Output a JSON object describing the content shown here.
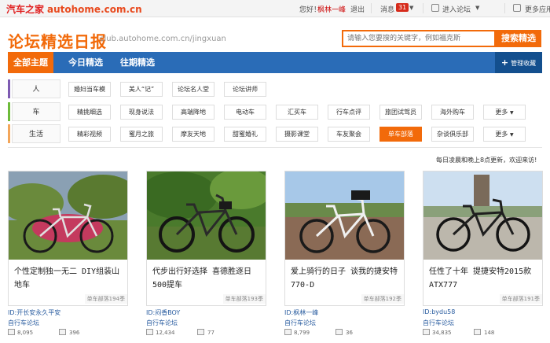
{
  "topbar": {
    "logo_cn": "汽车之家",
    "logo_en": "autohome.com.cn",
    "hello": "您好！",
    "username": "枫林一峰",
    "logout": "退出",
    "messages_label": "消息",
    "messages_count": "31",
    "enter_forum": "进入论坛",
    "more_apps": "更多应用"
  },
  "header": {
    "title": "论坛精选日报",
    "url": "club.autohome.com.cn/jingxuan",
    "search_placeholder": "请输入您要搜的关键字，例如福克斯",
    "search_button": "搜索精选"
  },
  "nav": {
    "tabs": [
      "全部主题",
      "今日精选",
      "往期精选"
    ],
    "manage": "管理收藏"
  },
  "categories": [
    {
      "label": "人",
      "color": "#7e5bb2",
      "tags": [
        "婚妇当车模",
        "美人“记”",
        "论坛名人堂",
        "论坛讲师"
      ]
    },
    {
      "label": "车",
      "color": "#6dbb3a",
      "tags": [
        "精挑细选",
        "现身说法",
        "高端降地",
        "电动车",
        "汇买车",
        "行车点评",
        "旅团试驾员",
        "海外购车",
        "更多"
      ]
    },
    {
      "label": "生活",
      "color": "#f3a65a",
      "tags": [
        "精彩视频",
        "蜜月之旅",
        "摩友天地",
        "甜蜜婚礼",
        "摄影课堂",
        "车友聚会",
        "单车部落",
        "杂谈俱乐部",
        "更多"
      ]
    }
  ],
  "update_note": "每日凌晨和晚上8点更新，欢迎来访!",
  "cards": [
    {
      "title": "个性定制独一无二 DIY组装山地车",
      "tag": "单车部落194季",
      "author_id": "ID:开长安永久平安",
      "forum": "自行车论坛",
      "views": "8,095",
      "replies": "396",
      "bg": "#8a9fb2",
      "ground": "#6a8a3c",
      "frame": "#1a1a1a",
      "accent": "#e04a6a"
    },
    {
      "title": "代步出行好选择 喜德胜逐日500提车",
      "tag": "单车部落193季",
      "author_id": "ID:闷香BOY",
      "forum": "自行车论坛",
      "views": "12,434",
      "replies": "77",
      "bg": "#5c8a3a",
      "ground": "#4a6b2c",
      "frame": "#1f1f1f",
      "accent": "#d8d8d8"
    },
    {
      "title": "爱上骑行的日子 谈我的捷安特770-D",
      "tag": "单车部落192季",
      "author_id": "ID:枫林一峰",
      "forum": "自行车论坛",
      "views": "8,799",
      "replies": "36",
      "bg": "#9cc2e6",
      "ground": "#8a6a55",
      "frame": "#e6e6e6",
      "accent": "#1a1a1a"
    },
    {
      "title": "任性了十年 提捷安特2015款ATX777",
      "tag": "单车部落191季",
      "author_id": "ID:bydu58",
      "forum": "自行车论坛",
      "views": "34,835",
      "replies": "148",
      "bg": "#c9dcef",
      "ground": "#b8b4aa",
      "frame": "#1a1a1a",
      "accent": "#c8c8c8"
    }
  ]
}
